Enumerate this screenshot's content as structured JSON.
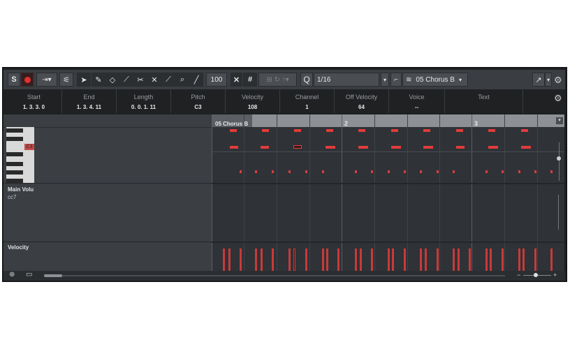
{
  "toolbar": {
    "solo_label": "S",
    "quantize_label": "Q",
    "quantize_value": "1/16",
    "velocity_value": "100",
    "part_name": "05 Chorus B"
  },
  "info": [
    {
      "label": "Start",
      "value": "1. 3. 3.   0"
    },
    {
      "label": "End",
      "value": "1. 3. 4. 11"
    },
    {
      "label": "Length",
      "value": "0. 0. 1. 11"
    },
    {
      "label": "Pitch",
      "value": "C3"
    },
    {
      "label": "Velocity",
      "value": "108"
    },
    {
      "label": "Channel",
      "value": "1"
    },
    {
      "label": "Off Velocity",
      "value": "64"
    },
    {
      "label": "Voice",
      "value": "--"
    },
    {
      "label": "Text",
      "value": ""
    }
  ],
  "ruler": {
    "part_label": "05 Chorus B",
    "bar2": "2",
    "bar3": "3"
  },
  "keys": {
    "c3_label": "C3"
  },
  "lanes": {
    "main_volume": "Main Volu",
    "cc": "cc7",
    "velocity": "Velocity"
  },
  "colors": {
    "note": "#e03c3c",
    "velocity_bar": "#c83a3a",
    "record": "#e03030"
  }
}
